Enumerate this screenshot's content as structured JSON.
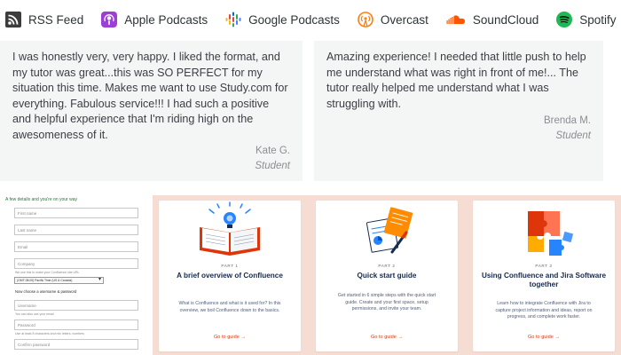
{
  "podcast_bar": {
    "items": [
      {
        "label": "RSS Feed",
        "icon": "rss-icon"
      },
      {
        "label": "Apple Podcasts",
        "icon": "apple-podcasts-icon"
      },
      {
        "label": "Google Podcasts",
        "icon": "google-podcasts-icon"
      },
      {
        "label": "Overcast",
        "icon": "overcast-icon"
      },
      {
        "label": "SoundCloud",
        "icon": "soundcloud-icon"
      },
      {
        "label": "Spotify",
        "icon": "spotify-icon"
      }
    ]
  },
  "testimonials": [
    {
      "quote": "I was honestly very, very happy. I liked the format, and my tutor was great...this was SO PERFECT for my situation this time. Makes me want to use Study.com for everything. Fabulous service!!! I had such a positive and helpful experience that I'm riding high on the awesomeness of it.",
      "author": "Kate G.",
      "role": "Student"
    },
    {
      "quote": "Amazing experience! I needed that little push to help me understand what was right in front of me!... The tutor really helped me understand what I was struggling with.",
      "author": "Brenda M.",
      "role": "Student"
    }
  ],
  "signup": {
    "heading": "A few details and you're on your way",
    "first_name": "First name",
    "last_name": "Last name",
    "email": "Email",
    "company": "Company",
    "company_hint": "We use this to make your Confluence site URL",
    "timezone": "(GMT-08:00) Pacific Time (US & Canada)",
    "credentials_heading": "Now choose a username & password",
    "username": "Username",
    "username_hint": "You can also use your email",
    "password": "Password",
    "password_hint": "Use at least 8 characters and mix letters, numbers",
    "confirm_password": "Confirm password"
  },
  "guides": {
    "accent": "#de350b",
    "cards": [
      {
        "part": "PART 1",
        "title": "A brief overview of Confluence",
        "description": "What is Confluence and what is it used for? In this overview, we boil Confluence down to the basics.",
        "cta": "Go to guide →"
      },
      {
        "part": "PART 2",
        "title": "Quick start guide",
        "description": "Get started in 6 simple steps with the quick start guide. Create and your first space, setup permissions, and invite your team.",
        "cta": "Go to guide →"
      },
      {
        "part": "PART 3",
        "title": "Using Confluence and Jira Software together",
        "description": "Learn how to integrate Confluence with Jira to capture project information and ideas, report on progress, and complete work faster.",
        "cta": "Go to guide →"
      }
    ]
  }
}
